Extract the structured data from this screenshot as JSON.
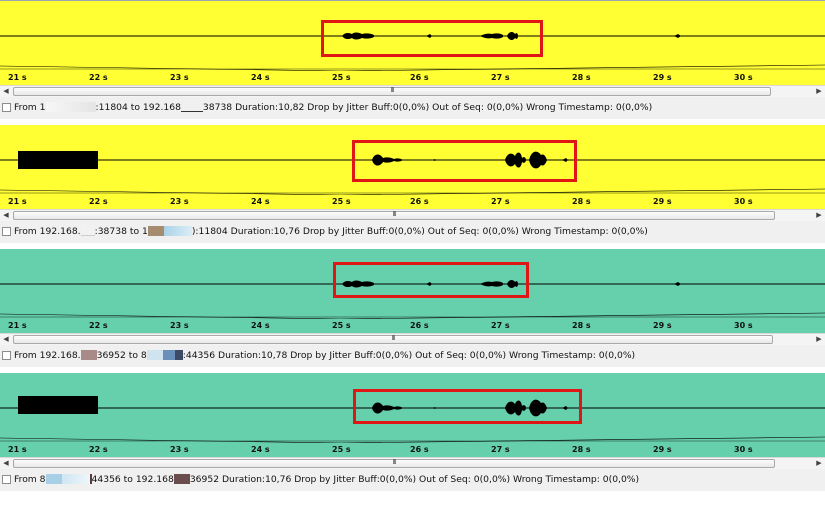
{
  "colors": {
    "yellow_bg": "#ffff33",
    "teal_bg": "#66cfac",
    "highlight": "#e01515"
  },
  "ticks": [
    "21 s",
    "22 s",
    "23 s",
    "24 s",
    "25 s",
    "26 s",
    "27 s",
    "28 s",
    "29 s",
    "30 s"
  ],
  "scroll_grip": "III",
  "streams": [
    {
      "bg": "yellow",
      "info": {
        "p1": "From 1",
        "p2": ":11804 to 192.168",
        "p3": "38738",
        "p4": "  Duration:10,82   Drop by Jitter Buff:0(0,0%)   Out of Seq: 0(0,0%)   Wrong Timestamp: 0(0,0%)"
      }
    },
    {
      "bg": "yellow",
      "info": {
        "p1": "From 192.168.",
        "p2": ":38738 to 1",
        "p3": "):11804",
        "p4": "  Duration:10,76   Drop by Jitter Buff:0(0,0%)   Out of Seq: 0(0,0%)   Wrong Timestamp: 0(0,0%)"
      }
    },
    {
      "bg": "teal",
      "info": {
        "p1": "From 192.168.",
        "p2": "36952 to 8",
        "p3": ":44356",
        "p4": "  Duration:10,78   Drop by Jitter Buff:0(0,0%)   Out of Seq: 0(0,0%)   Wrong Timestamp: 0(0,0%)"
      }
    },
    {
      "bg": "teal",
      "info": {
        "p1": "From 8",
        "p2": "44356 to 192.168",
        "p3": "36952",
        "p4": "  Duration:10,76   Drop by Jitter Buff:0(0,0%)   Out of Seq: 0(0,0%)   Wrong Timestamp: 0(0,0%)"
      }
    }
  ]
}
